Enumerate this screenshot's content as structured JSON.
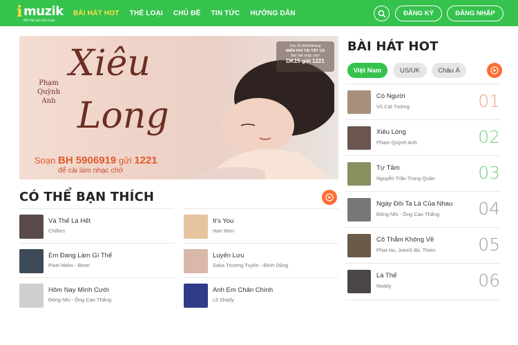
{
  "header": {
    "logo_text": "muzik",
    "logo_tagline": "Mở thế giới âm nhạc",
    "nav": [
      "BÀI HÁT HOT",
      "THỂ LOẠI",
      "CHỦ ĐỀ",
      "TIN TỨC",
      "HƯỚNG DẪN"
    ],
    "register_label": "ĐĂNG KÝ",
    "login_label": "ĐĂNG NHẬP",
    "search_icon": "search-icon",
    "brand_color": "#35c24d",
    "active_nav_color": "#ffe14a"
  },
  "banner": {
    "artist_line1": "Phạm",
    "artist_line2": "Quỳnh",
    "artist_line3": "Anh",
    "title_line1": "Xiêu",
    "title_line2": "Long",
    "sms_prefix": "Soạn",
    "sms_code": "BH 5906919",
    "sms_mid": "gửi",
    "sms_number": "1221",
    "sms_line2": "để cài làm nhạc chờ",
    "promo_line1": "Giá 15.000đ/tháng",
    "promo_line2": "MIỄN PHÍ TẢI TẤT CẢ",
    "promo_line3": "Bài hát nhạc chờ",
    "promo_code": "DK15 gửi 1221"
  },
  "suggest": {
    "title": "CÓ THỂ BẠN THÍCH",
    "play_icon": "play-icon",
    "items": [
      {
        "title": "Và Thế Là Hết",
        "artist": "Chillies",
        "color": "#5a4a4a"
      },
      {
        "title": "It's You",
        "artist": "Hari Won",
        "color": "#e7c4a0"
      },
      {
        "title": "Em Đang Làm Gì Thế",
        "artist": "Pixel Neko - Binm",
        "color": "#3d4a57"
      },
      {
        "title": "Luyến Lưu",
        "artist": "Saka Trương Tuyền - Đình Dũng",
        "color": "#d9b7a9"
      },
      {
        "title": "Hôm Nay Mình Cưới",
        "artist": "Đông Nhi - Ông Cao Thắng",
        "color": "#cfcfcf"
      },
      {
        "title": "Anh Em Chân Chính",
        "artist": "Lil Shady",
        "color": "#2f3c8a"
      }
    ]
  },
  "hot": {
    "title": "BÀI HÁT HOT",
    "play_icon": "play-icon",
    "tabs": [
      "Việt Nam",
      "US/UK",
      "Châu Á"
    ],
    "active_tab": 0,
    "rank_color": "#6fcf7d",
    "rank_color_first": "#f0a07a",
    "items": [
      {
        "rank": "01",
        "title": "Có Người",
        "artist": "Vũ Cát Tường",
        "color": "#a98f7a"
      },
      {
        "rank": "02",
        "title": "Xiêu Lòng",
        "artist": "Phạm Quỳnh Anh",
        "color": "#6a5550"
      },
      {
        "rank": "03",
        "title": "Tự Tâm",
        "artist": "Nguyễn Trần Trung Quân",
        "color": "#8a8f60"
      },
      {
        "rank": "04",
        "title": "Ngày Đôi Ta Là Của Nhau",
        "artist": "Đông Nhi - Ông Cao Thắng",
        "color": "#777777"
      },
      {
        "rank": "05",
        "title": "Cô Thắm Không Về",
        "artist": "Phat Ho, JokeS Bii, Thien",
        "color": "#6b5a4a"
      },
      {
        "rank": "06",
        "title": "Là Thế",
        "artist": "Reddy",
        "color": "#4b4545"
      }
    ]
  }
}
